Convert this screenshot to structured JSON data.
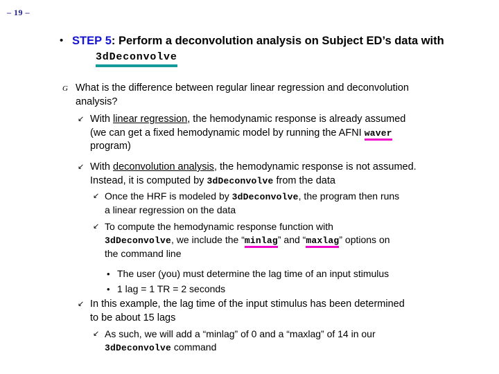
{
  "slide": {
    "page_number": "– 19 –",
    "background_color": "#ffffff",
    "accent_blue": "#1414d2",
    "accent_navy": "#21218c",
    "accent_teal": "#169a9a",
    "accent_magenta": "#f009c8"
  },
  "title": {
    "bullet": "•",
    "step_label": "STEP",
    "step_number": "5",
    "colon_rest": ": Perform a deconvolution analysis on Subject ED’s data with",
    "command": "3dDeconvolve"
  },
  "outline": {
    "l2_bullet": "G",
    "l3_bullet": "↙",
    "l4_bullet": "↙",
    "l5_bullet": "•",
    "items": [
      {
        "id": "question",
        "level": 2,
        "line1": "What is the difference between regular linear regression and deconvolution",
        "line2": "analysis?"
      },
      {
        "id": "linear-regression",
        "level": 3,
        "pre": "With ",
        "underlined": "linear regression",
        "post": ", the hemodynamic response is already assumed",
        "line2_pre": "(we can get a fixed hemodynamic model by running the AFNI ",
        "line2_mono_hl": "waver",
        "line3": "program)"
      },
      {
        "id": "deconvolution-analysis",
        "level": 3,
        "pre": "With ",
        "underlined": "deconvolution analysis",
        "post": ", the hemodynamic response is not assumed.",
        "line2_pre": "Instead, it is computed by ",
        "line2_mono": "3dDeconvolve",
        "line2_post": " from the data"
      },
      {
        "id": "hrf-modeled",
        "level": 4,
        "pre": "Once the HRF is modeled by ",
        "mono": "3dDeconvolve",
        "post": ", the program then runs",
        "line2": "a linear regression on the data"
      },
      {
        "id": "compute-hrf",
        "level": 4,
        "line1": "To compute the hemodynamic response function with",
        "line2_mono": "3dDeconvolve",
        "line2_mid": ", we include the “",
        "line2_hl_a": "minlag",
        "line2_mid2": "” and “",
        "line2_hl_b": "maxlag",
        "line2_post": "” options on",
        "line3": "the command line"
      },
      {
        "id": "user-lag-time",
        "level": 5,
        "line1": "The user (you) must determine the lag time of an input stimulus"
      },
      {
        "id": "lag-equals",
        "level": 5,
        "line1": "1 lag = 1 TR = 2 seconds"
      },
      {
        "id": "example-lag",
        "level": 3,
        "line1": "In this example, the lag time of the input stimulus has been determined",
        "line2": "to be about 15 lags"
      },
      {
        "id": "as-such",
        "level": 4,
        "line1": "As such, we will add a “minlag” of 0 and a “maxlag” of 14 in our",
        "line2_mono": "3dDeconvolve",
        "line2_post": " command"
      }
    ]
  }
}
